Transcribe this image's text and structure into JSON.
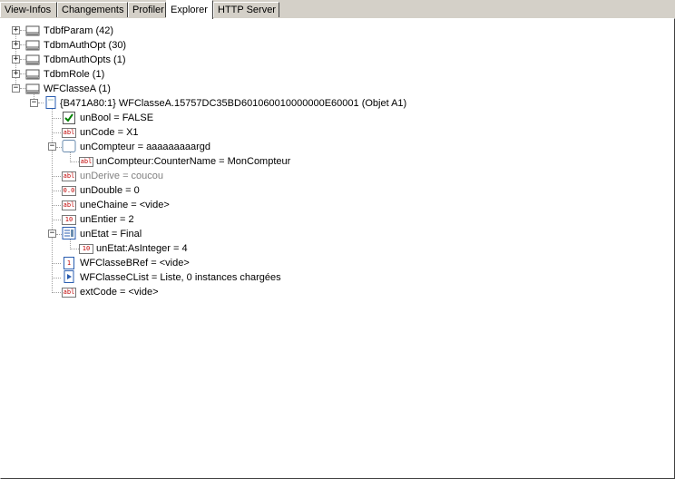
{
  "tabs": [
    {
      "label": "View-Infos"
    },
    {
      "label": "Changements"
    },
    {
      "label": "Profiler"
    },
    {
      "label": "Explorer",
      "active": true
    },
    {
      "label": "HTTP Server"
    }
  ],
  "tree": {
    "roots": [
      {
        "label": "TdbfParam (42)"
      },
      {
        "label": "TdbmAuthOpt (30)"
      },
      {
        "label": "TdbmAuthOpts (1)"
      },
      {
        "label": "TdbmRole (1)"
      },
      {
        "label": "WFClasseA (1)"
      }
    ],
    "object": {
      "label": "{B471A80:1} WFClasseA.15757DC35BD601060010000000E60001 (Objet A1)"
    },
    "fields": [
      {
        "label": "unBool = FALSE",
        "icon": "checkbox-checked-icon"
      },
      {
        "label": "unCode = X1",
        "icon": "string-field-icon",
        "badge": "abl"
      },
      {
        "label": "unCompteur = aaaaaaaaargd",
        "icon": "counter-field-icon"
      },
      {
        "label": "unCompteur:CounterName = MonCompteur",
        "icon": "string-field-icon",
        "badge": "abl"
      },
      {
        "label": "unDerive = coucou",
        "icon": "string-field-icon",
        "badge": "abl"
      },
      {
        "label": "unDouble = 0",
        "icon": "double-field-icon",
        "badge": "0.0"
      },
      {
        "label": "uneChaine = <vide>",
        "icon": "string-field-icon",
        "badge": "abl"
      },
      {
        "label": "unEntier = 2",
        "icon": "integer-field-icon",
        "badge": "10"
      },
      {
        "label": "unEtat = Final",
        "icon": "enum-field-icon"
      },
      {
        "label": "unEtat:AsInteger = 4",
        "icon": "integer-field-icon",
        "badge": "10"
      },
      {
        "label": "WFClasseBRef = <vide>",
        "icon": "reference-field-icon",
        "badge": "1"
      },
      {
        "label": "WFClasseCList = Liste, 0 instances chargées",
        "icon": "list-field-icon"
      },
      {
        "label": "extCode = <vide>",
        "icon": "string-field-icon",
        "badge": "abl"
      }
    ]
  },
  "colors": {
    "accent_green": "#008000",
    "badge_red": "#c00000",
    "icon_blue": "#2a5db0",
    "disabled_text": "#808080"
  }
}
